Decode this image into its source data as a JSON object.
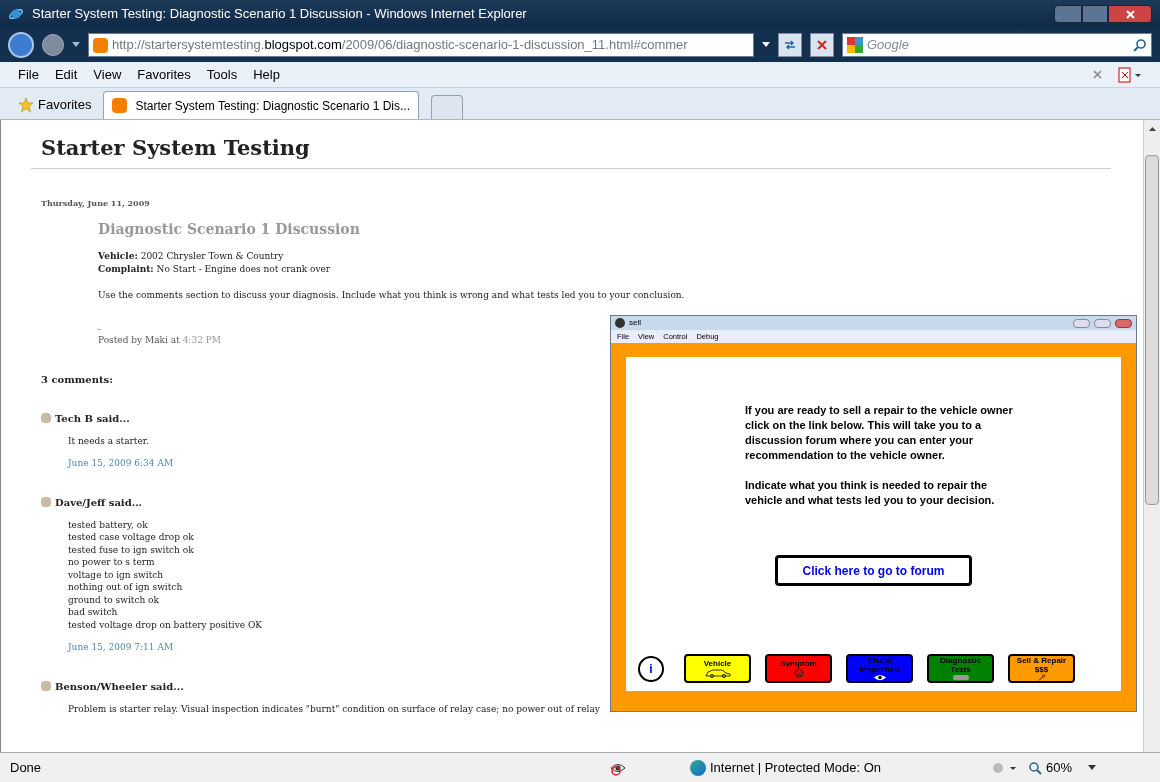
{
  "window": {
    "title": "Starter System Testing: Diagnostic Scenario 1 Discussion - Windows Internet Explorer"
  },
  "address_bar": {
    "url_prefix": "http://startersystemtesting.",
    "url_domain": "blogspot.com",
    "url_path": "/2009/06/diagnostic-scenario-1-discussion_11.html#commer"
  },
  "search": {
    "placeholder": "Google"
  },
  "menu": [
    "File",
    "Edit",
    "View",
    "Favorites",
    "Tools",
    "Help"
  ],
  "favorites_bar": {
    "label": "Favorites",
    "tabs": [
      {
        "label": "Starter System Testing: Diagnostic Scenario 1 Dis...",
        "selected": true
      }
    ]
  },
  "blog": {
    "title": "Starter System Testing",
    "date": "Thursday, June 11, 2009",
    "post_title": "Diagnostic Scenario 1 Discussion",
    "body": [
      "**Vehicle:** 2002 Chrysler Town & Country",
      "**Complaint:** No Start - Engine does not crank over"
    ],
    "paragraph": "Use the comments section to discuss your diagnosis. Include what you think is wrong and what tests led you to your conclusion.",
    "dash": "-",
    "posted_by": "Posted by Maki at",
    "posted_time": "4:32 PM",
    "comments_heading": "3 comments:",
    "comments": [
      {
        "author": "Tech B said...",
        "lines": [
          "It needs a starter."
        ],
        "time": "June 15, 2009 6:34 AM"
      },
      {
        "author": "Dave/Jeff said...",
        "lines": [
          "tested battery, ok",
          "tested case voltage drop ok",
          "tested fuse to ign switch ok",
          "no power to s term",
          "voltage to ign switch",
          "nothing out of ign switch",
          "ground to switch ok",
          "bad switch",
          "tested voltage drop on battery positive OK"
        ],
        "time": "June 15, 2009 7:11 AM"
      },
      {
        "author": "Benson/Wheeler said...",
        "lines": [
          "Problem is starter relay. Visual inspection indicates \"burnt\" condition on surface of relay case; no power out of relay"
        ]
      }
    ]
  },
  "flash_window": {
    "title": "sell",
    "menu": [
      "File",
      "View",
      "Control",
      "Debug"
    ],
    "message": [
      "If you are ready to sell a repair to the vehicle owner click on the link below.  This will take you to a discussion forum where you can enter your recommendation to the vehicle owner.",
      "Indicate what you think is needed to repair the vehicle and what tests led you to your decision."
    ],
    "forum_button": "Click here to go to forum",
    "info_label": "i",
    "nav": [
      {
        "label": "Vehicle",
        "kind": "car",
        "color": "#ffff00"
      },
      {
        "label": "Symptom",
        "kind": "face",
        "color": "#ff0000"
      },
      {
        "label": "Visual Inspection",
        "kind": "eye",
        "color": "#0000ff"
      },
      {
        "label": "Diagnostic Tests",
        "kind": "meter",
        "color": "#008000"
      },
      {
        "label": "Sell & Repair $$$",
        "kind": "wrench",
        "color": "#ff9900"
      }
    ]
  },
  "status_bar": {
    "text": "Done",
    "zone": "Internet | Protected Mode: On",
    "zoom": "60%"
  }
}
